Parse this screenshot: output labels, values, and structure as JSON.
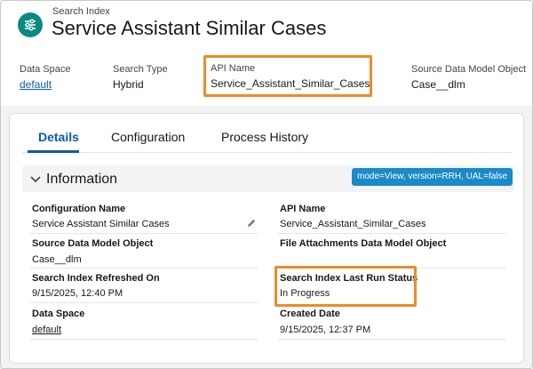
{
  "header": {
    "subtitle": "Search Index",
    "title": "Service Assistant Similar Cases",
    "highlights": [
      {
        "label": "Data Space",
        "value": "default",
        "link": true
      },
      {
        "label": "Search Type",
        "value": "Hybrid",
        "link": false
      },
      {
        "label": "API Name",
        "value": "Service_Assistant_Similar_Cases",
        "link": false
      },
      {
        "label": "Source Data Model Object",
        "value": "Case__dlm",
        "link": false
      }
    ]
  },
  "tabs": [
    {
      "label": "Details",
      "active": true
    },
    {
      "label": "Configuration",
      "active": false
    },
    {
      "label": "Process History",
      "active": false
    }
  ],
  "section": {
    "title": "Information",
    "mode_badge": "mode=View, version=RRH, UAL=false"
  },
  "fields": {
    "left": [
      {
        "label": "Configuration Name",
        "value": "Service Assistant Similar Cases"
      },
      {
        "label": "Source Data Model Object",
        "value": "Case__dlm"
      },
      {
        "label": "Search Index Refreshed On",
        "value": "9/15/2025, 12:40 PM"
      },
      {
        "label": "Data Space",
        "value": "default"
      }
    ],
    "right": [
      {
        "label": "API Name",
        "value": "Service_Assistant_Similar_Cases"
      },
      {
        "label": "File Attachments Data Model Object",
        "value": ""
      },
      {
        "label": "Search Index Last Run Status",
        "value": "In Progress"
      },
      {
        "label": "Created Date",
        "value": "9/15/2025, 12:37 PM"
      }
    ]
  },
  "colors": {
    "brand_icon": "#0b8a83",
    "link": "#0b5cab",
    "highlight_box": "#ef8a2a",
    "badge": "#1b8ac9"
  }
}
